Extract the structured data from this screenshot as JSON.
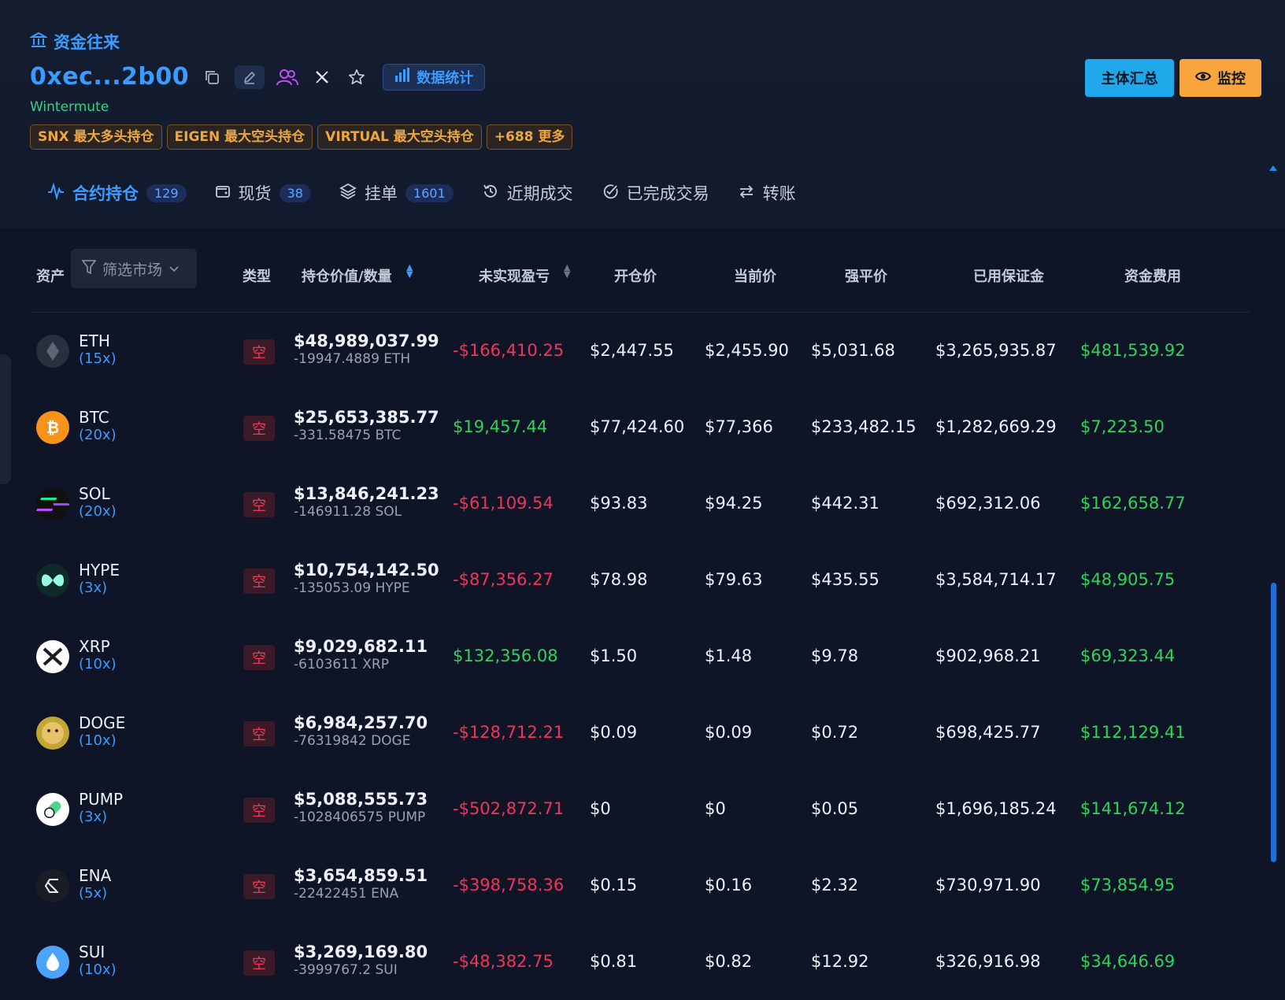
{
  "header": {
    "section_title": "资金往来",
    "address": "0xec...2b00",
    "stats_label": "数据统计",
    "entity": "Wintermute",
    "tags": [
      "SNX 最大多头持仓",
      "EIGEN 最大空头持仓",
      "VIRTUAL 最大空头持仓",
      "+688 更多"
    ],
    "summary_label": "主体汇总",
    "monitor_label": "监控"
  },
  "tabs": [
    {
      "label": "合约持仓",
      "count": "129"
    },
    {
      "label": "现货",
      "count": "38"
    },
    {
      "label": "挂单",
      "count": "1601"
    },
    {
      "label": "近期成交",
      "count": ""
    },
    {
      "label": "已完成交易",
      "count": ""
    },
    {
      "label": "转账",
      "count": ""
    }
  ],
  "table": {
    "headers": {
      "asset": "资产",
      "filter": "筛选市场",
      "type": "类型",
      "value": "持仓价值/数量",
      "pnl": "未实现盈亏",
      "entry": "开仓价",
      "mark": "当前价",
      "liq": "强平价",
      "margin": "已用保证金",
      "funding": "资金费用"
    },
    "rows": [
      {
        "symbol": "ETH",
        "leverage": "(15x)",
        "type": "空",
        "value": "$48,989,037.99",
        "qty": "-19947.4889 ETH",
        "pnl": "-$166,410.25",
        "pnl_sign": "neg",
        "entry": "$2,447.55",
        "mark": "$2,455.90",
        "liq": "$5,031.68",
        "margin": "$3,265,935.87",
        "funding": "$481,539.92",
        "icon": "eth-icon",
        "color": "#2a2f3d"
      },
      {
        "symbol": "BTC",
        "leverage": "(20x)",
        "type": "空",
        "value": "$25,653,385.77",
        "qty": "-331.58475 BTC",
        "pnl": "$19,457.44",
        "pnl_sign": "pos",
        "entry": "$77,424.60",
        "mark": "$77,366",
        "liq": "$233,482.15",
        "margin": "$1,282,669.29",
        "funding": "$7,223.50",
        "icon": "btc-icon",
        "color": "#f7931a"
      },
      {
        "symbol": "SOL",
        "leverage": "(20x)",
        "type": "空",
        "value": "$13,846,241.23",
        "qty": "-146911.28 SOL",
        "pnl": "-$61,109.54",
        "pnl_sign": "neg",
        "entry": "$93.83",
        "mark": "$94.25",
        "liq": "$442.31",
        "margin": "$692,312.06",
        "funding": "$162,658.77",
        "icon": "sol-icon",
        "color": "#111111"
      },
      {
        "symbol": "HYPE",
        "leverage": "(3x)",
        "type": "空",
        "value": "$10,754,142.50",
        "qty": "-135053.09 HYPE",
        "pnl": "-$87,356.27",
        "pnl_sign": "neg",
        "entry": "$78.98",
        "mark": "$79.63",
        "liq": "$435.55",
        "margin": "$3,584,714.17",
        "funding": "$48,905.75",
        "icon": "hype-icon",
        "color": "#0e2a2a"
      },
      {
        "symbol": "XRP",
        "leverage": "(10x)",
        "type": "空",
        "value": "$9,029,682.11",
        "qty": "-6103611 XRP",
        "pnl": "$132,356.08",
        "pnl_sign": "pos",
        "entry": "$1.50",
        "mark": "$1.48",
        "liq": "$9.78",
        "margin": "$902,968.21",
        "funding": "$69,323.44",
        "icon": "xrp-icon",
        "color": "#ffffff"
      },
      {
        "symbol": "DOGE",
        "leverage": "(10x)",
        "type": "空",
        "value": "$6,984,257.70",
        "qty": "-76319842 DOGE",
        "pnl": "-$128,712.21",
        "pnl_sign": "neg",
        "entry": "$0.09",
        "mark": "$0.09",
        "liq": "$0.72",
        "margin": "$698,425.77",
        "funding": "$112,129.41",
        "icon": "doge-icon",
        "color": "#c2a633"
      },
      {
        "symbol": "PUMP",
        "leverage": "(3x)",
        "type": "空",
        "value": "$5,088,555.73",
        "qty": "-1028406575 PUMP",
        "pnl": "-$502,872.71",
        "pnl_sign": "neg",
        "entry": "$0",
        "mark": "$0",
        "liq": "$0.05",
        "margin": "$1,696,185.24",
        "funding": "$141,674.12",
        "icon": "pump-icon",
        "color": "#ffffff"
      },
      {
        "symbol": "ENA",
        "leverage": "(5x)",
        "type": "空",
        "value": "$3,654,859.51",
        "qty": "-22422451 ENA",
        "pnl": "-$398,758.36",
        "pnl_sign": "neg",
        "entry": "$0.15",
        "mark": "$0.16",
        "liq": "$2.32",
        "margin": "$730,971.90",
        "funding": "$73,854.95",
        "icon": "ena-icon",
        "color": "#1a1d24"
      },
      {
        "symbol": "SUI",
        "leverage": "(10x)",
        "type": "空",
        "value": "$3,269,169.80",
        "qty": "-3999767.2 SUI",
        "pnl": "-$48,382.75",
        "pnl_sign": "neg",
        "entry": "$0.81",
        "mark": "$0.82",
        "liq": "$12.92",
        "margin": "$326,916.98",
        "funding": "$34,646.69",
        "icon": "sui-icon",
        "color": "#4ca2ff"
      }
    ]
  }
}
